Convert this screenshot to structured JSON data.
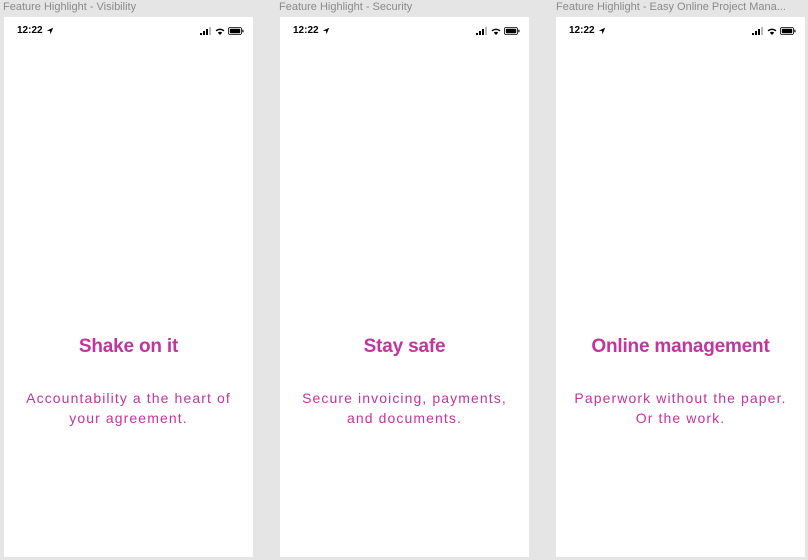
{
  "artboards": [
    {
      "label": "Feature Highlight  - Visibility",
      "time": "12:22",
      "headline": "Shake on it",
      "line1": "Accountability a the heart of",
      "line2": "your agreement."
    },
    {
      "label": "Feature Highlight - Security",
      "time": "12:22",
      "headline": "Stay safe",
      "line1": "Secure invoicing, payments,",
      "line2": "and documents."
    },
    {
      "label": "Feature Highlight - Easy Online Project Mana...",
      "time": "12:22",
      "headline": "Online management",
      "line1": "Paperwork without the paper.",
      "line2": "Or the work."
    }
  ],
  "colors": {
    "accent": "#c2359e",
    "canvas": "#e5e5e5",
    "screen": "#ffffff",
    "label": "#8a8a8a"
  },
  "icons": {
    "status": [
      "location-arrow-icon",
      "cellular-signal-icon",
      "wifi-icon",
      "battery-icon"
    ]
  }
}
